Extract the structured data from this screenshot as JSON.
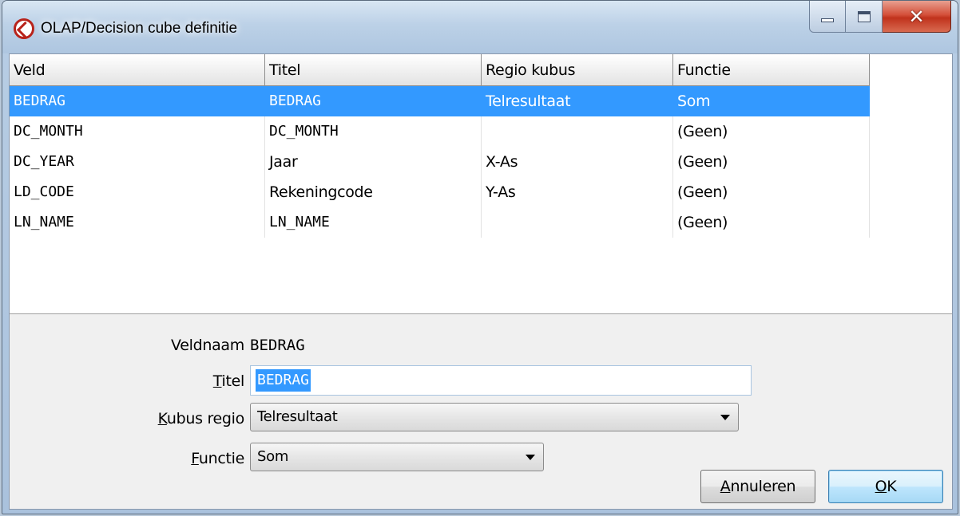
{
  "window": {
    "title": "OLAP/Decision cube definitie"
  },
  "grid": {
    "headers": [
      "Veld",
      "Titel",
      "Regio kubus",
      "Functie"
    ],
    "rows": [
      {
        "veld": "BEDRAG",
        "titel": "BEDRAG",
        "regio": "Telresultaat",
        "functie": "Som",
        "selected": true
      },
      {
        "veld": "DC_MONTH",
        "titel": "DC_MONTH",
        "regio": "",
        "functie": "(Geen)"
      },
      {
        "veld": "DC_YEAR",
        "titel": "Jaar",
        "regio": "X-As",
        "functie": "(Geen)"
      },
      {
        "veld": "LD_CODE",
        "titel": "Rekeningcode",
        "regio": "Y-As",
        "functie": "(Geen)"
      },
      {
        "veld": "LN_NAME",
        "titel": "LN_NAME",
        "regio": "",
        "functie": "(Geen)"
      }
    ]
  },
  "form": {
    "veldnaam_label": "Veldnaam",
    "veldnaam_value": "BEDRAG",
    "titel_label_mnemonic": "T",
    "titel_label_rest": "itel",
    "titel_value": "BEDRAG",
    "kubus_label_mnemonic": "K",
    "kubus_label_rest": "ubus regio",
    "kubus_value": "Telresultaat",
    "functie_label_mnemonic": "F",
    "functie_label_rest": "unctie",
    "functie_value": "Som"
  },
  "buttons": {
    "cancel_mnemonic": "A",
    "cancel_rest": "nnuleren",
    "ok_mnemonic": "O",
    "ok_rest": "K"
  }
}
